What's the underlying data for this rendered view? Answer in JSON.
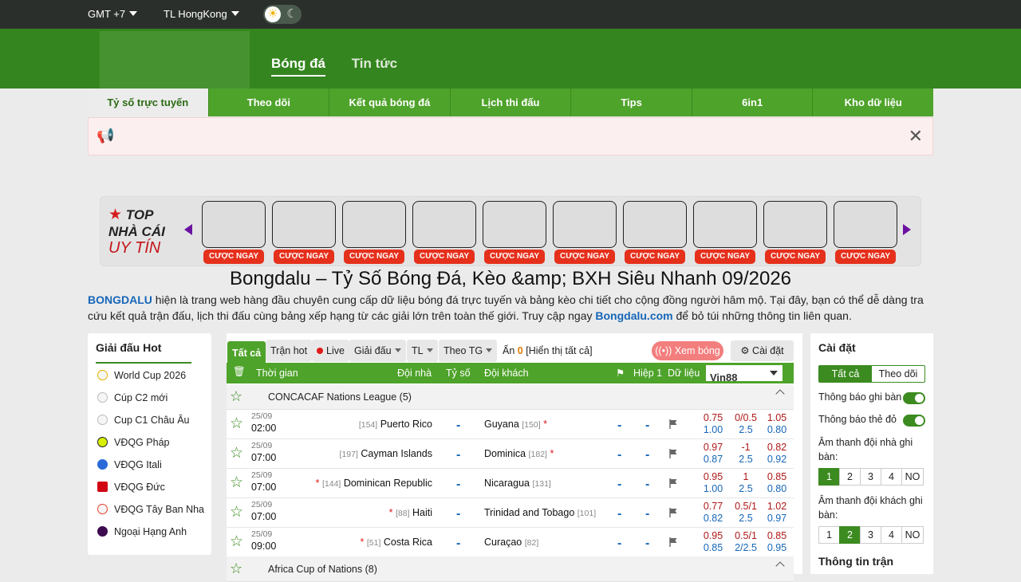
{
  "topbar": {
    "timezone": "GMT +7",
    "odds_type": "TL HongKong"
  },
  "header": {
    "nav": [
      "Bóng đá",
      "Tin tức"
    ]
  },
  "subnav": [
    "Tỷ số trực tuyến",
    "Theo dõi",
    "Kết quả bóng đá",
    "Lịch thi đấu",
    "Tips",
    "6in1",
    "Kho dữ liệu"
  ],
  "promo": {
    "line1": "TOP",
    "line2": "NHÀ CÁI",
    "line3": "UY TÍN",
    "cta": "CƯỢC NGAY"
  },
  "page": {
    "title": "Bongdalu – Tỷ Số Bóng Đá, Kèo &amp; BXH Siêu Nhanh 09/2026",
    "intro_brand": "BONGDALU",
    "intro_text": " hiện là trang web hàng đầu chuyên cung cấp dữ liệu bóng đá trực tuyến và bảng kèo chi tiết cho cộng đồng người hâm mộ. Tại đây, bạn có thể dễ dàng tra cứu kết quả trận đấu, lịch thi đấu cùng bảng xếp hạng từ các giải lớn trên toàn thế giới. Truy cập ngay ",
    "intro_link": "Bongdalu.com",
    "intro_tail": " để bỏ túi những thông tin liên quan."
  },
  "hot_leagues": {
    "title": "Giải đấu Hot",
    "items": [
      "World Cup 2026",
      "Cúp C2 mới",
      "Cup C1 Châu Âu",
      "VĐQG Pháp",
      "VĐQG Itali",
      "VĐQG Đức",
      "VĐQG Tây Ban Nha",
      "Ngoại Hạng Anh"
    ]
  },
  "filters": {
    "all": "Tất cả",
    "hot": "Trận hot",
    "live": "Live",
    "league": "Giải đấu",
    "tl": "TL",
    "sort": "Theo TG",
    "hidden_label": "Ẩn",
    "hidden_count": "0",
    "show_all": "[Hiển thị tất cả]",
    "watch": "Xem bóng",
    "settings": "Cài đặt"
  },
  "table": {
    "headers": {
      "time": "Thời gian",
      "home": "Đội nhà",
      "score": "Tỷ số",
      "away": "Đội khách",
      "half": "Hiệp 1",
      "data": "Dữ liệu"
    },
    "bookmaker": "Vin88",
    "leagues": [
      {
        "name": "CONCACAF Nations League (5)"
      },
      {
        "name": "Africa Cup of Nations (8)"
      }
    ],
    "matches": [
      {
        "date": "25/09",
        "time": "02:00",
        "home_rank": "[154]",
        "home": "Puerto Rico",
        "home_card": "",
        "away": "Guyana",
        "away_rank": "[150]",
        "away_card": "*",
        "score": "-",
        "h1": "-",
        "h2": "-",
        "o1a": "0.75",
        "o1b": "1.00",
        "o2a": "0/0.5",
        "o2b": "2.5",
        "o3a": "1.05",
        "o3b": "0.80"
      },
      {
        "date": "25/09",
        "time": "07:00",
        "home_rank": "[197]",
        "home": "Cayman Islands",
        "home_card": "",
        "away": "Dominica",
        "away_rank": "[182]",
        "away_card": "*",
        "score": "-",
        "h1": "-",
        "h2": "-",
        "o1a": "0.97",
        "o1b": "0.87",
        "o2a": "-1",
        "o2b": "2.5",
        "o3a": "0.82",
        "o3b": "0.92"
      },
      {
        "date": "25/09",
        "time": "07:00",
        "home_rank": "[144]",
        "home": "Dominican Republic",
        "home_card": "*",
        "away": "Nicaragua",
        "away_rank": "[131]",
        "away_card": "",
        "score": "-",
        "h1": "-",
        "h2": "-",
        "o1a": "0.95",
        "o1b": "1.00",
        "o2a": "1",
        "o2b": "2.5",
        "o3a": "0.85",
        "o3b": "0.80"
      },
      {
        "date": "25/09",
        "time": "07:00",
        "home_rank": "[88]",
        "home": "Haiti",
        "home_card": "*",
        "away": "Trinidad and Tobago",
        "away_rank": "[101]",
        "away_card": "",
        "score": "-",
        "h1": "-",
        "h2": "-",
        "o1a": "0.77",
        "o1b": "0.82",
        "o2a": "0.5/1",
        "o2b": "2.5",
        "o3a": "1.02",
        "o3b": "0.97"
      },
      {
        "date": "25/09",
        "time": "09:00",
        "home_rank": "[51]",
        "home": "Costa Rica",
        "home_card": "*",
        "away": "Curaçao",
        "away_rank": "[82]",
        "away_card": "",
        "score": "-",
        "h1": "-",
        "h2": "-",
        "o1a": "0.95",
        "o1b": "0.85",
        "o2a": "0.5/1",
        "o2b": "2/2.5",
        "o3a": "0.85",
        "o3b": "0.95"
      }
    ]
  },
  "settings": {
    "title": "Cài đặt",
    "seg_all": "Tất cả",
    "seg_follow": "Theo dõi",
    "goal_notify": "Thông báo ghi bàn",
    "card_notify": "Thông báo thẻ đỏ",
    "home_sound": "Âm thanh đội nhà ghi bàn:",
    "away_sound": "Âm thanh đội khách ghi bàn:",
    "options": [
      "1",
      "2",
      "3",
      "4",
      "NO"
    ],
    "home_selected": "1",
    "away_selected": "2",
    "match_info": "Thông tin trận"
  }
}
